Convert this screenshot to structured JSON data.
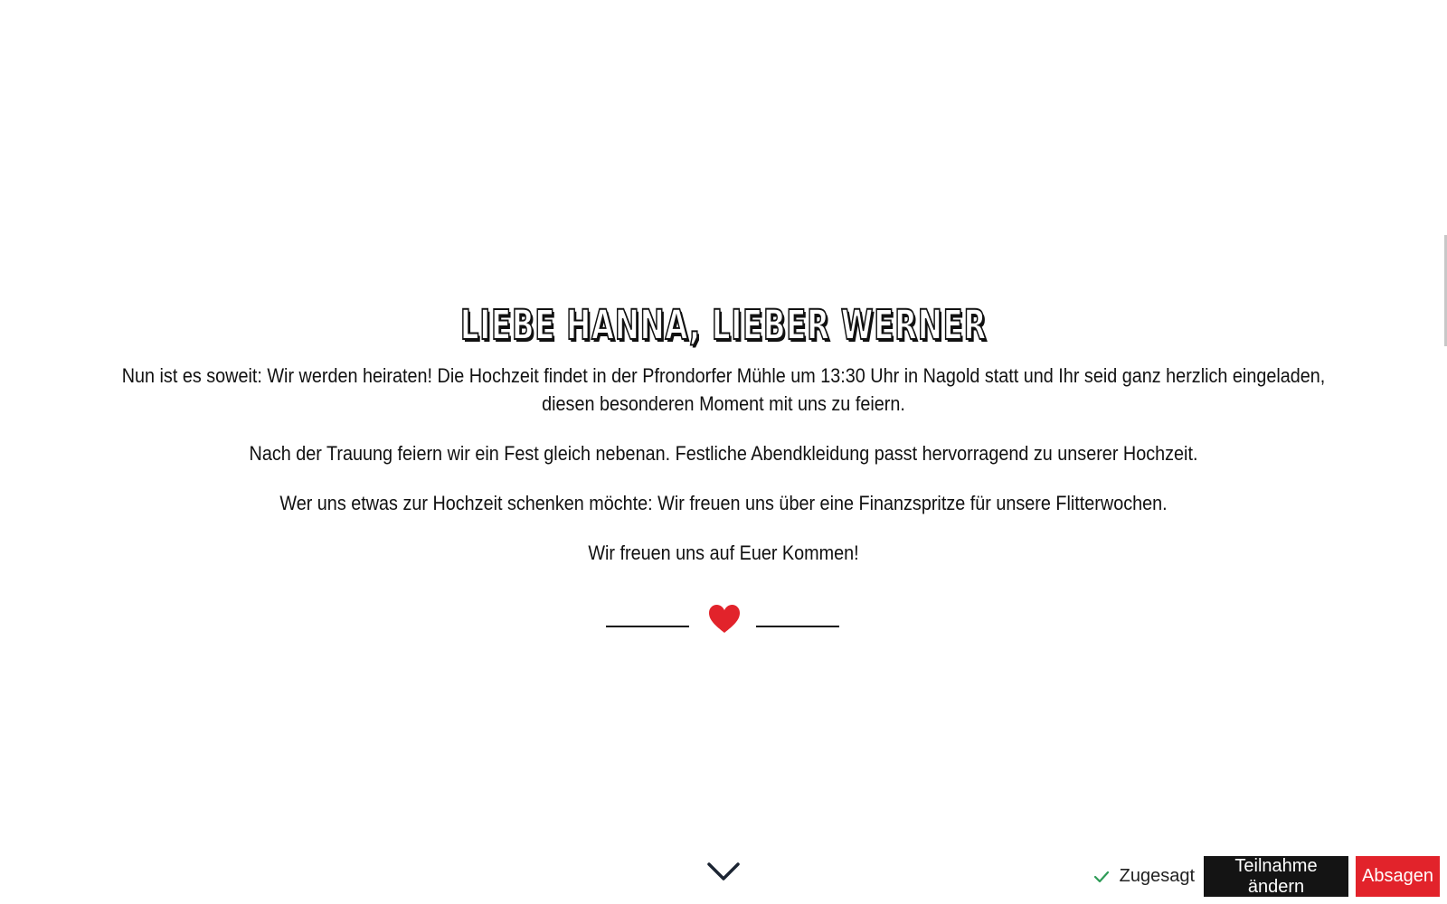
{
  "invitation": {
    "heading": "LIEBE HANNA, LIEBER WERNER",
    "paragraphs": [
      "Nun ist es soweit: Wir werden heiraten! Die Hochzeit findet in der Pfrondorfer Mühle um 13:30 Uhr in Nagold statt und Ihr seid ganz herzlich eingeladen, diesen besonderen Moment mit uns zu feiern.",
      "Nach der Trauung feiern wir ein Fest gleich nebenan. Festliche Abendkleidung passt hervorragend zu unserer Hochzeit.",
      "Wer uns etwas zur Hochzeit schenken möchte: Wir freuen uns über eine Finanzspritze für unsere Flitterwochen.",
      "Wir freuen uns auf Euer Kommen!"
    ],
    "divider_icon": "heart-icon"
  },
  "scroll_indicator": {
    "icon": "chevron-down-icon"
  },
  "rsvp": {
    "status_icon": "check-icon",
    "status_label": "Zugesagt",
    "change_label": "Teilnahme ändern",
    "decline_label": "Absagen"
  },
  "colors": {
    "accent_red": "#e2232b",
    "dark_button": "#141414",
    "check_green": "#2e9b57",
    "text": "#111111"
  }
}
